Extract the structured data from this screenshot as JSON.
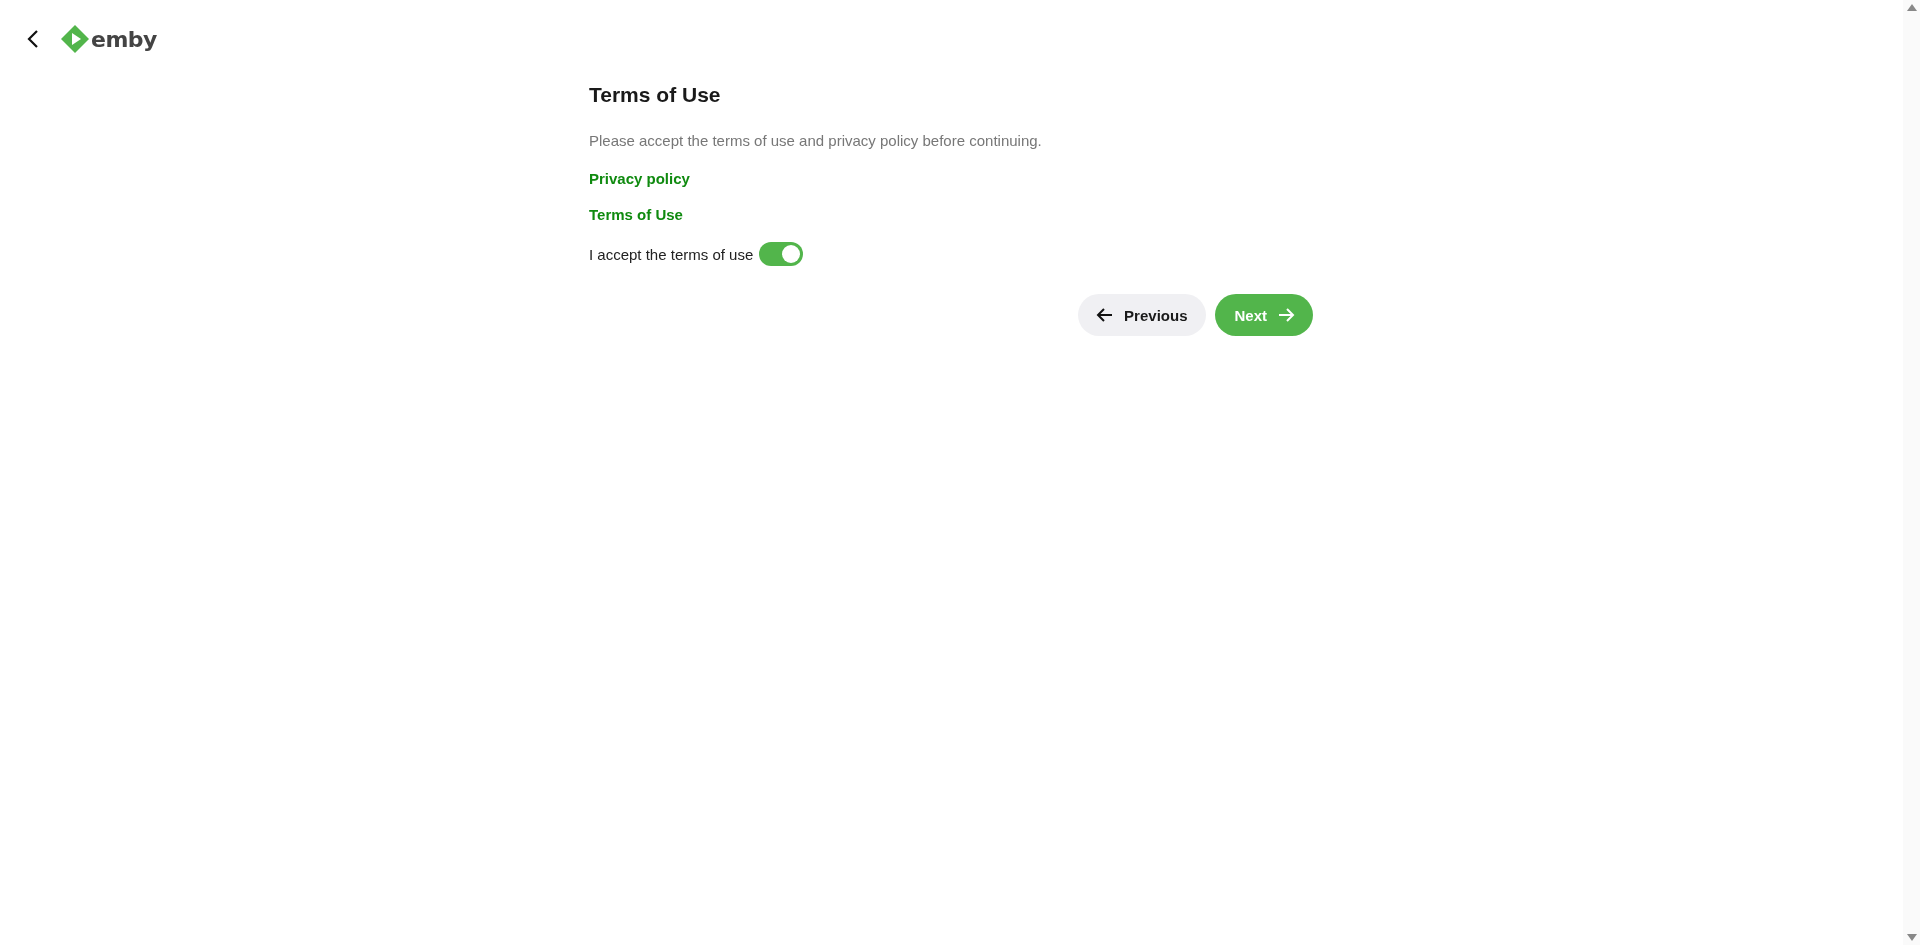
{
  "header": {
    "logo": "emby"
  },
  "page": {
    "title": "Terms of Use",
    "description": "Please accept the terms of use and privacy policy before continuing.",
    "links": [
      "Privacy policy",
      "Terms of Use"
    ],
    "accept": {
      "label": "I accept the terms of use",
      "on": true
    }
  },
  "buttons": [
    {
      "label": "Previous",
      "kind": "previous"
    },
    {
      "label": "Next",
      "kind": "next"
    }
  ]
}
